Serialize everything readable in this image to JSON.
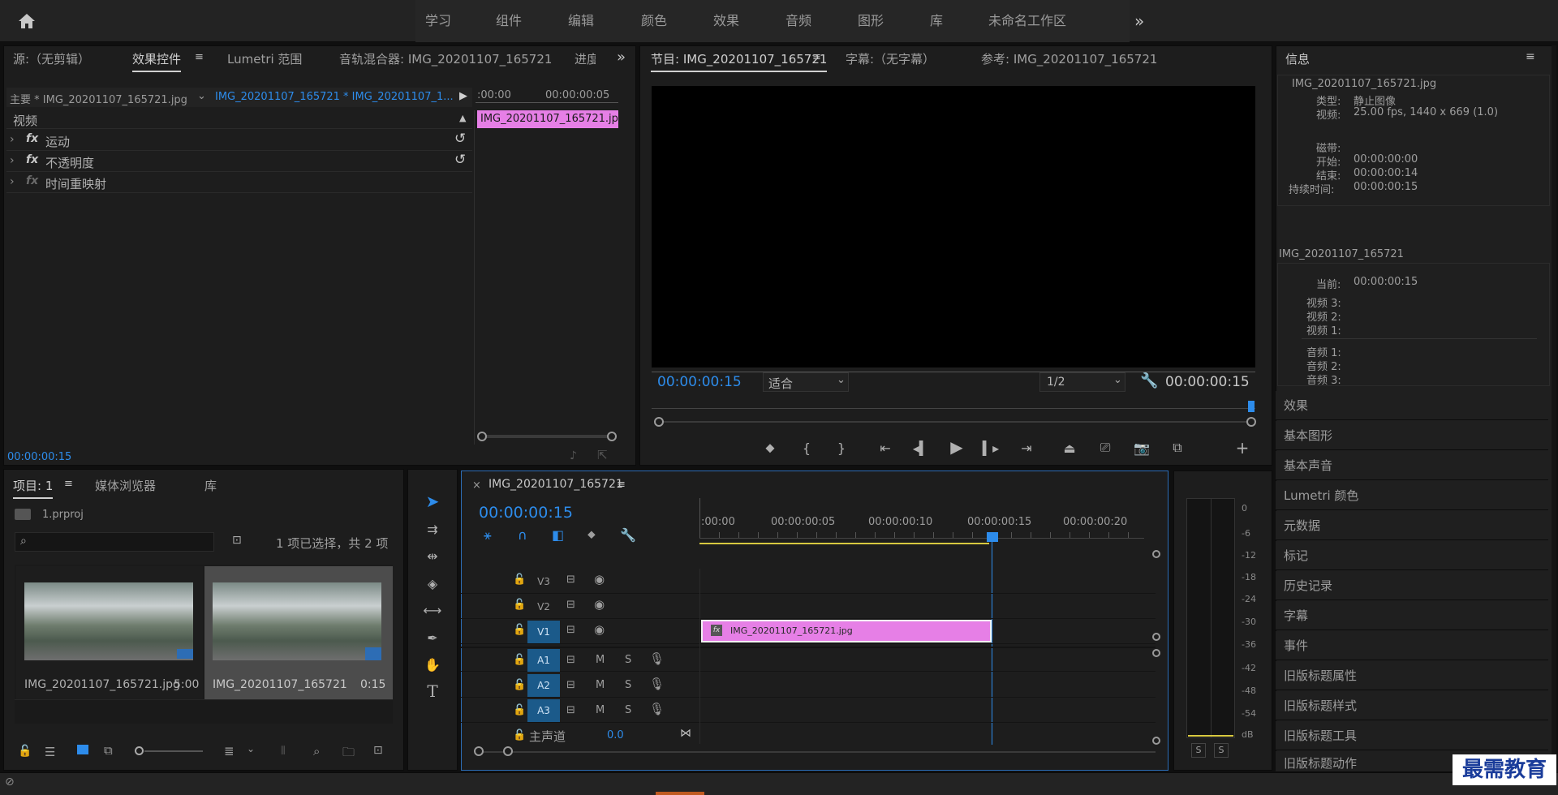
{
  "topbar": {
    "workspaces": [
      "学习",
      "组件",
      "编辑",
      "颜色",
      "效果",
      "音频",
      "图形",
      "库",
      "未命名工作区"
    ],
    "more": "»"
  },
  "effect_panel": {
    "tabs": [
      "源:（无剪辑）",
      "效果控件",
      "Lumetri 范围",
      "音轨混合器: IMG_20201107_165721",
      "进度"
    ],
    "active_tab": "效果控件",
    "master_label": "主要 * IMG_20201107_165721.jpg",
    "sequence_label": "IMG_20201107_165721 * IMG_20201107_1...",
    "ruler_start": ":00:00",
    "ruler_end": "00:00:00:05",
    "clip_label": "IMG_20201107_165721.jp",
    "section_video": "视频",
    "effects": [
      "运动",
      "不透明度",
      "时间重映射"
    ],
    "fx": "fx",
    "timecode": "00:00:00:15"
  },
  "program_monitor": {
    "tabs": [
      "节目: IMG_20201107_165721",
      "字幕:（无字幕）",
      "参考: IMG_20201107_165721"
    ],
    "active_tab": "节目: IMG_20201107_165721",
    "timecode_left": "00:00:00:15",
    "fit": "适合",
    "resolution": "1/2",
    "timecode_right": "00:00:00:15"
  },
  "info_panel": {
    "title": "信息",
    "file": "IMG_20201107_165721.jpg",
    "type_label": "类型:",
    "type_value": "静止图像",
    "video_label": "视频:",
    "video_value": "25.00 fps, 1440 x 669 (1.0)",
    "tape_label": "磁带:",
    "start_label": "开始:",
    "start_value": "00:00:00:00",
    "end_label": "结束:",
    "end_value": "00:00:00:14",
    "duration_label": "持续时间:",
    "duration_value": "00:00:00:15",
    "seq_name": "IMG_20201107_165721",
    "current_label": "当前:",
    "current_value": "00:00:00:15",
    "video_tracks": [
      "视频 3:",
      "视频 2:",
      "视频 1:"
    ],
    "audio_tracks": [
      "音频 1:",
      "音频 2:",
      "音频 3:"
    ]
  },
  "side_list": [
    "效果",
    "基本图形",
    "基本声音",
    "Lumetri 颜色",
    "元数据",
    "标记",
    "历史记录",
    "字幕",
    "事件",
    "旧版标题属性",
    "旧版标题样式",
    "旧版标题工具",
    "旧版标题动作"
  ],
  "project_panel": {
    "tabs": [
      "项目: 1",
      "媒体浏览器",
      "库"
    ],
    "active_tab": "项目: 1",
    "project_file": "1.prproj",
    "search_placeholder": "",
    "selection": "1 项已选择，共 2 项",
    "items": [
      {
        "name": "IMG_20201107_165721.jpg",
        "duration": "5:00"
      },
      {
        "name": "IMG_20201107_165721",
        "duration": "0:15"
      }
    ]
  },
  "timeline": {
    "tab": "IMG_20201107_165721",
    "close": "×",
    "timecode": "00:00:00:15",
    "ruler": [
      ":00:00",
      "00:00:00:05",
      "00:00:00:10",
      "00:00:00:15",
      "00:00:00:20"
    ],
    "video_tracks": [
      "V3",
      "V2",
      "V1"
    ],
    "audio_tracks": [
      "A1",
      "A2",
      "A3"
    ],
    "mute": "M",
    "solo": "S",
    "master_label": "主声道",
    "master_value": "0.0",
    "clip_label": "IMG_20201107_165721.jpg",
    "fx": "fx"
  },
  "audio_meter": {
    "scale": [
      "0",
      "-6",
      "-12",
      "-18",
      "-24",
      "-30",
      "-36",
      "-42",
      "-48",
      "-54",
      "dB"
    ],
    "solo_left": "S",
    "solo_right": "S"
  },
  "watermark": "最需教育",
  "colors": {
    "accent": "#2d8ceb",
    "clip_pink": "#e67fe6",
    "track_blue": "#1b5a8a"
  }
}
